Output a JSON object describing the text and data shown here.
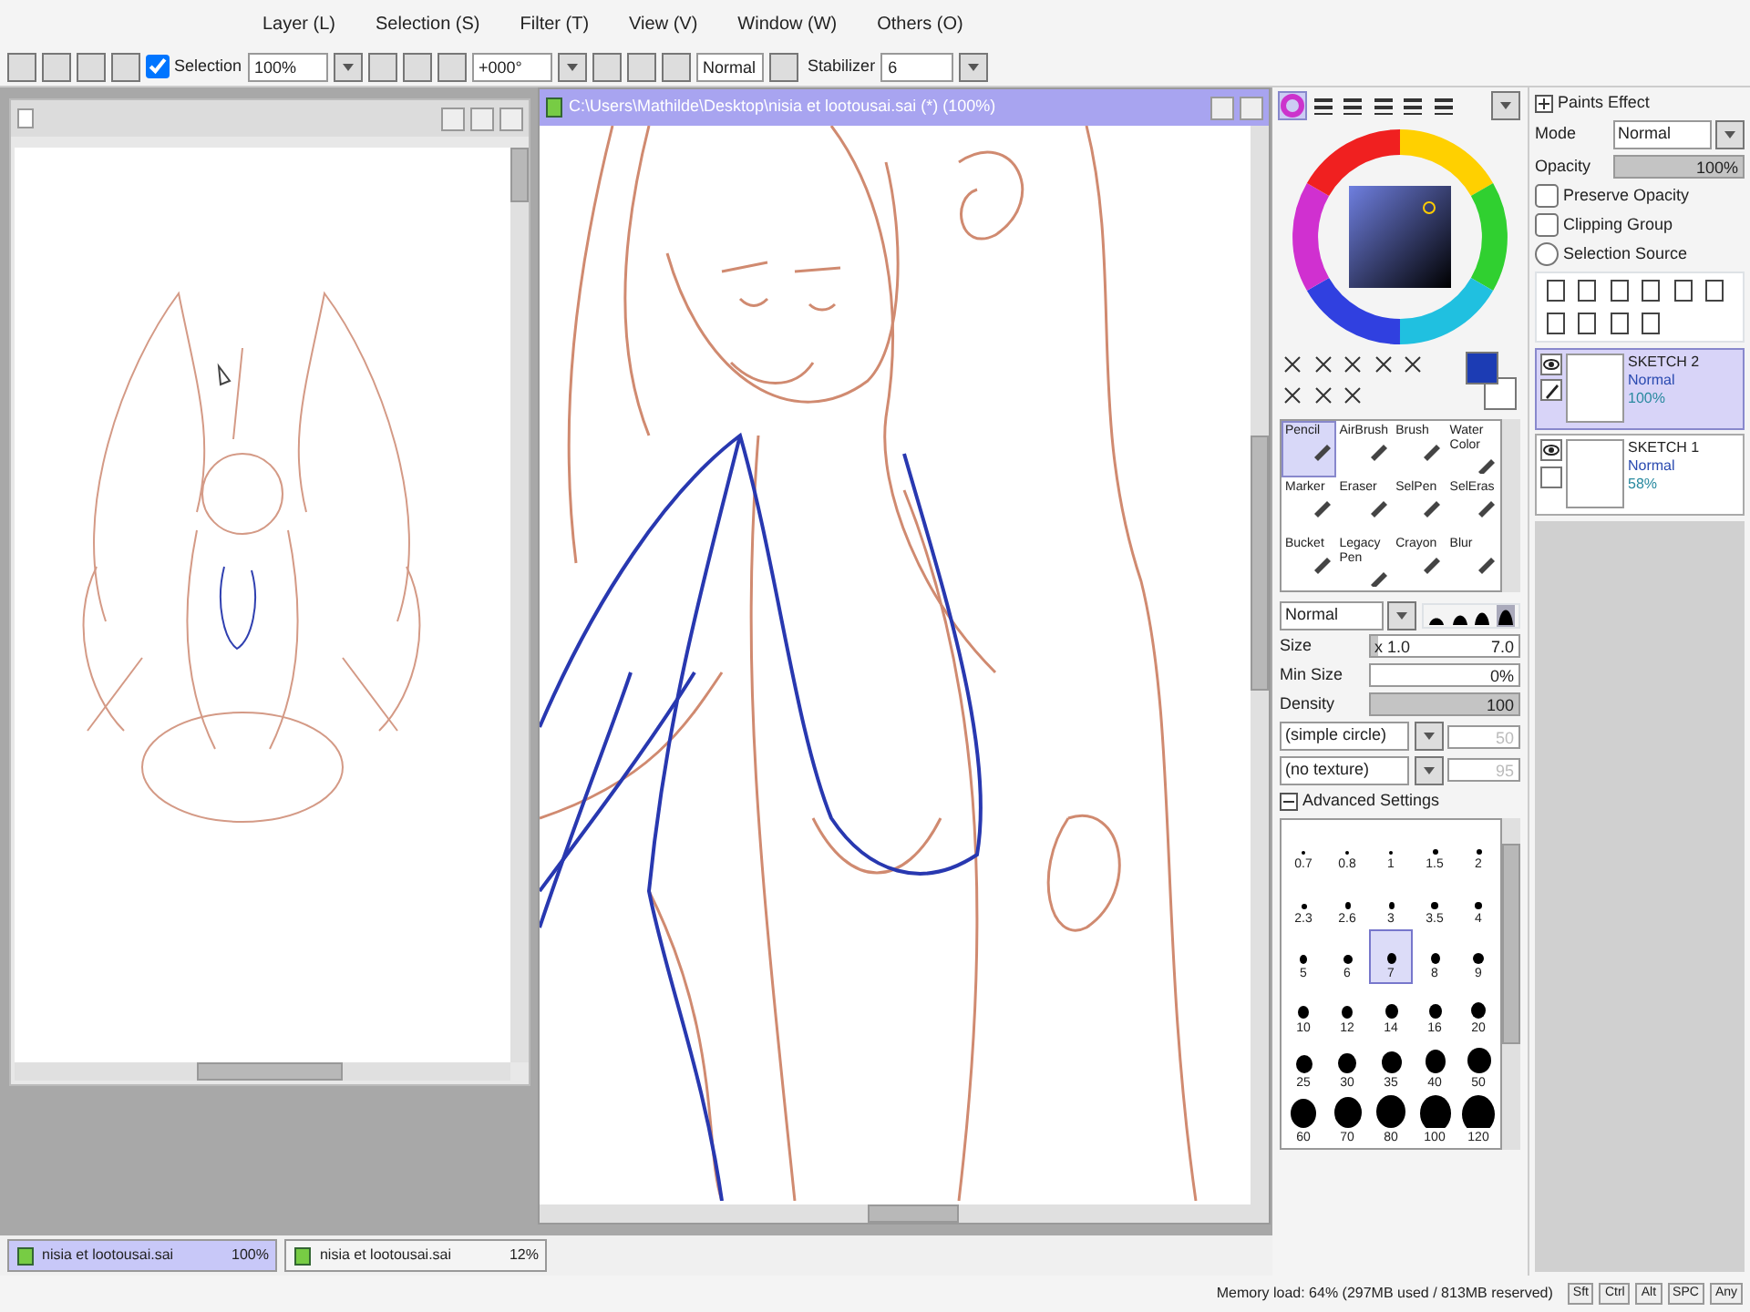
{
  "menu": [
    "Layer (L)",
    "Selection (S)",
    "Filter (T)",
    "View (V)",
    "Window (W)",
    "Others (O)"
  ],
  "toolbar": {
    "selection_checked": true,
    "selection_label": "Selection",
    "zoom": "100%",
    "rotation": "+000°",
    "mode": "Normal",
    "stabilizer_label": "Stabilizer",
    "stabilizer": "6"
  },
  "canvas_window": {
    "title": "C:\\Users\\Mathilde\\Desktop\\nisia et lootousai.sai (*) (100%)",
    "active": true
  },
  "color_panel": {
    "modes": [
      {
        "selected": true
      },
      {
        "selected": false
      },
      {
        "selected": false
      },
      {
        "selected": false
      },
      {
        "selected": false
      },
      {
        "selected": false
      }
    ]
  },
  "tools": [
    {
      "label": "Pencil",
      "selected": true
    },
    {
      "label": "AirBrush",
      "selected": false
    },
    {
      "label": "Brush",
      "selected": false
    },
    {
      "label": "Water Color",
      "selected": false
    },
    {
      "label": "Marker",
      "selected": false
    },
    {
      "label": "Eraser",
      "selected": false
    },
    {
      "label": "SelPen",
      "selected": false
    },
    {
      "label": "SelEras",
      "selected": false
    },
    {
      "label": "Bucket",
      "selected": false
    },
    {
      "label": "Legacy Pen",
      "selected": false
    },
    {
      "label": "Crayon",
      "selected": false
    },
    {
      "label": "Blur",
      "selected": false
    }
  ],
  "brush": {
    "blend": "Normal",
    "shapes": [
      {
        "selected": false
      },
      {
        "selected": false
      },
      {
        "selected": false
      },
      {
        "selected": true
      }
    ],
    "size_label": "Size",
    "size": {
      "multiplier": "x 1.0",
      "value": "7.0",
      "level": 0.05
    },
    "min_size_label": "Min Size",
    "min_size": "0%",
    "density_label": "Density",
    "density": {
      "value": "100",
      "level": 1
    },
    "shape": "(simple circle)",
    "shape_strength": "50",
    "shape_disabled": true,
    "texture": "(no texture)",
    "texture_strength": "95",
    "texture_disabled": true,
    "advanced_label": "Advanced Settings",
    "advanced_expanded": true
  },
  "brush_sizes": [
    {
      "label": "0.7",
      "selected": false
    },
    {
      "label": "0.8",
      "selected": false
    },
    {
      "label": "1",
      "selected": false
    },
    {
      "label": "1.5",
      "selected": false
    },
    {
      "label": "2",
      "selected": false
    },
    {
      "label": "2.3",
      "selected": false
    },
    {
      "label": "2.6",
      "selected": false
    },
    {
      "label": "3",
      "selected": false
    },
    {
      "label": "3.5",
      "selected": false
    },
    {
      "label": "4",
      "selected": false
    },
    {
      "label": "5",
      "selected": false
    },
    {
      "label": "6",
      "selected": false
    },
    {
      "label": "7",
      "selected": true
    },
    {
      "label": "8",
      "selected": false
    },
    {
      "label": "9",
      "selected": false
    },
    {
      "label": "10",
      "selected": false
    },
    {
      "label": "12",
      "selected": false
    },
    {
      "label": "14",
      "selected": false
    },
    {
      "label": "16",
      "selected": false
    },
    {
      "label": "20",
      "selected": false
    },
    {
      "label": "25",
      "selected": false
    },
    {
      "label": "30",
      "selected": false
    },
    {
      "label": "35",
      "selected": false
    },
    {
      "label": "40",
      "selected": false
    },
    {
      "label": "50",
      "selected": false
    },
    {
      "label": "60",
      "selected": false
    },
    {
      "label": "70",
      "selected": false
    },
    {
      "label": "80",
      "selected": false
    },
    {
      "label": "100",
      "selected": false
    },
    {
      "label": "120",
      "selected": false
    }
  ],
  "layer_props": {
    "title": "Paints Effect",
    "mode_label": "Mode",
    "mode": "Normal",
    "opacity_label": "Opacity",
    "opacity": {
      "value": "100%",
      "level": 1
    },
    "options": [
      {
        "label": "Preserve Opacity",
        "kind": "checkbox",
        "checked": false
      },
      {
        "label": "Clipping Group",
        "kind": "checkbox",
        "checked": false
      },
      {
        "label": "Selection Source",
        "kind": "radio",
        "checked": false
      }
    ]
  },
  "layers": [
    {
      "name": "SKETCH 2",
      "mode": "Normal",
      "opacity": "100%",
      "selected": true,
      "visible": true
    },
    {
      "name": "SKETCH 1",
      "mode": "Normal",
      "opacity": "58%",
      "selected": false,
      "visible": true
    }
  ],
  "tabs": [
    {
      "label": "nisia et lootousai.sai",
      "zoom": "100%",
      "selected": true
    },
    {
      "label": "nisia et lootousai.sai",
      "zoom": "12%",
      "selected": false
    }
  ],
  "status": {
    "memory": "Memory load: 64% (297MB used / 813MB reserved)",
    "keys": [
      "Sft",
      "Ctrl",
      "Alt",
      "SPC",
      "Any"
    ]
  }
}
